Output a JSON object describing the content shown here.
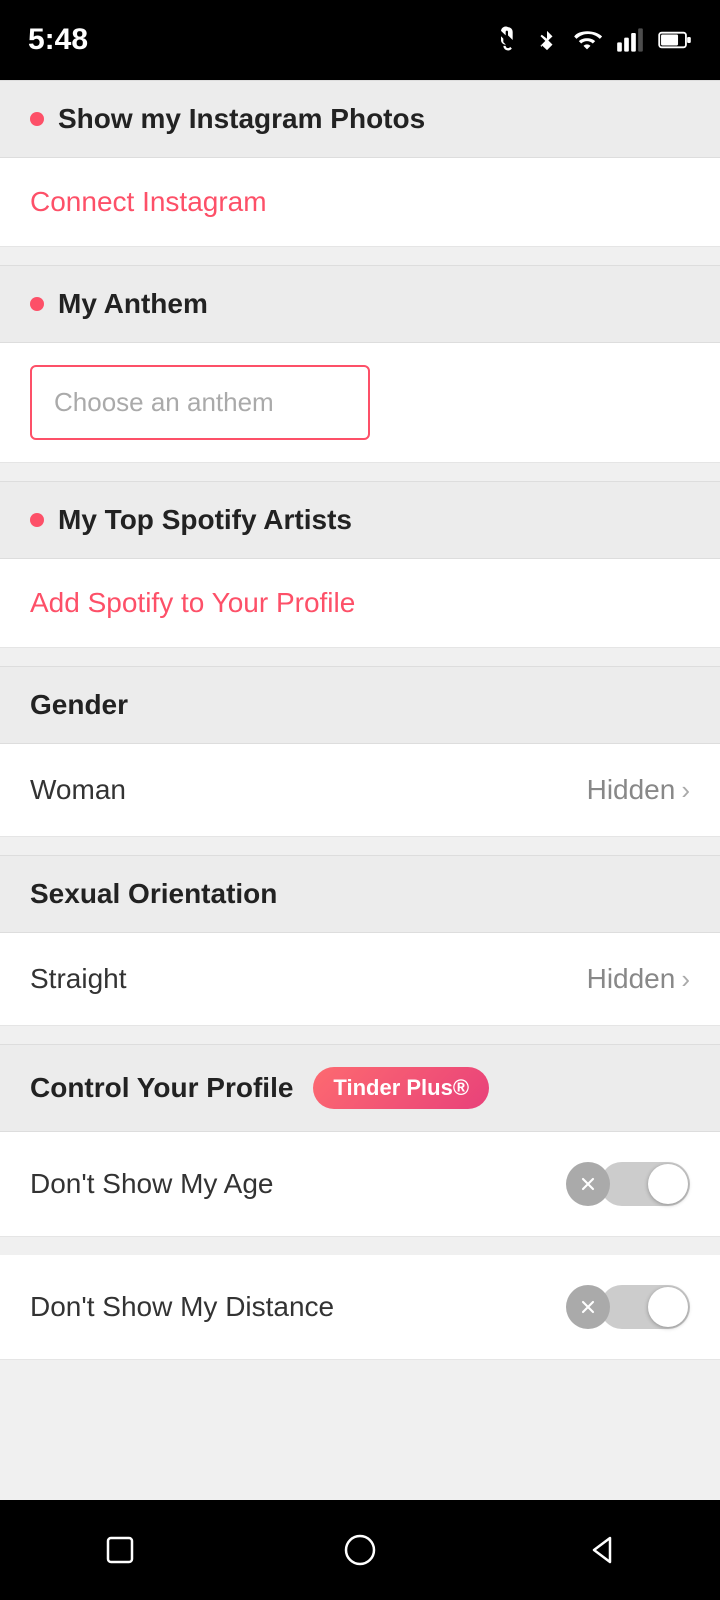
{
  "statusBar": {
    "time": "5:48"
  },
  "sections": {
    "instagram": {
      "title": "Show my Instagram Photos",
      "connectLabel": "Connect Instagram"
    },
    "anthem": {
      "title": "My Anthem",
      "placeholder": "Choose an anthem"
    },
    "spotify": {
      "title": "My Top Spotify Artists",
      "connectLabel": "Add Spotify to Your Profile"
    },
    "gender": {
      "title": "Gender",
      "value": "Woman",
      "visibility": "Hidden"
    },
    "sexualOrientation": {
      "title": "Sexual Orientation",
      "value": "Straight",
      "visibility": "Hidden"
    },
    "controlProfile": {
      "title": "Control Your Profile",
      "badge": "Tinder Plus®"
    },
    "dontShowAge": {
      "label": "Don't Show My Age"
    },
    "dontShowDistance": {
      "label": "Don't Show My Distance"
    }
  },
  "bottomNav": {
    "icons": [
      "square",
      "circle",
      "triangle"
    ]
  }
}
